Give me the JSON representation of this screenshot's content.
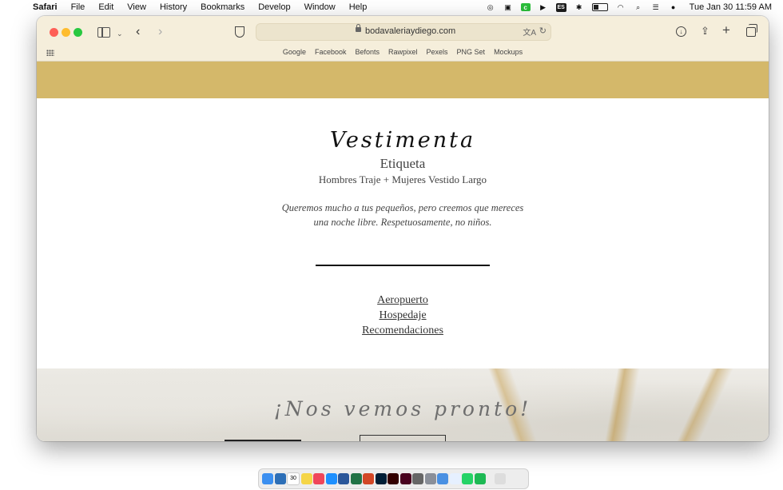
{
  "menubar": {
    "app_name": "Safari",
    "items": [
      "File",
      "Edit",
      "View",
      "History",
      "Bookmarks",
      "Develop",
      "Window",
      "Help"
    ],
    "input_source": "ES",
    "clock": "Tue Jan 30  11:59 AM"
  },
  "browser": {
    "url": "bodavaleriaydiego.com",
    "favorites": [
      "Google",
      "Facebook",
      "Befonts",
      "Rawpixel",
      "Pexels",
      "PNG Set",
      "Mockups"
    ]
  },
  "page": {
    "title": "Vestimenta",
    "subtitle": "Etiqueta",
    "dress_code": "Hombres Traje + Mujeres Vestido Largo",
    "note": "Queremos mucho a tus pequeños, pero creemos que mereces una noche libre. Respetuosamente, no niños.",
    "links": [
      "Aeropuerto",
      "Hospedaje",
      "Recomendaciones"
    ],
    "footer_heading": "¡Nos vemos pronto!"
  },
  "colors": {
    "header_band": "#d4b86a",
    "titlebar": "#f5eedb"
  },
  "dock": {
    "calendar_day": "30"
  }
}
